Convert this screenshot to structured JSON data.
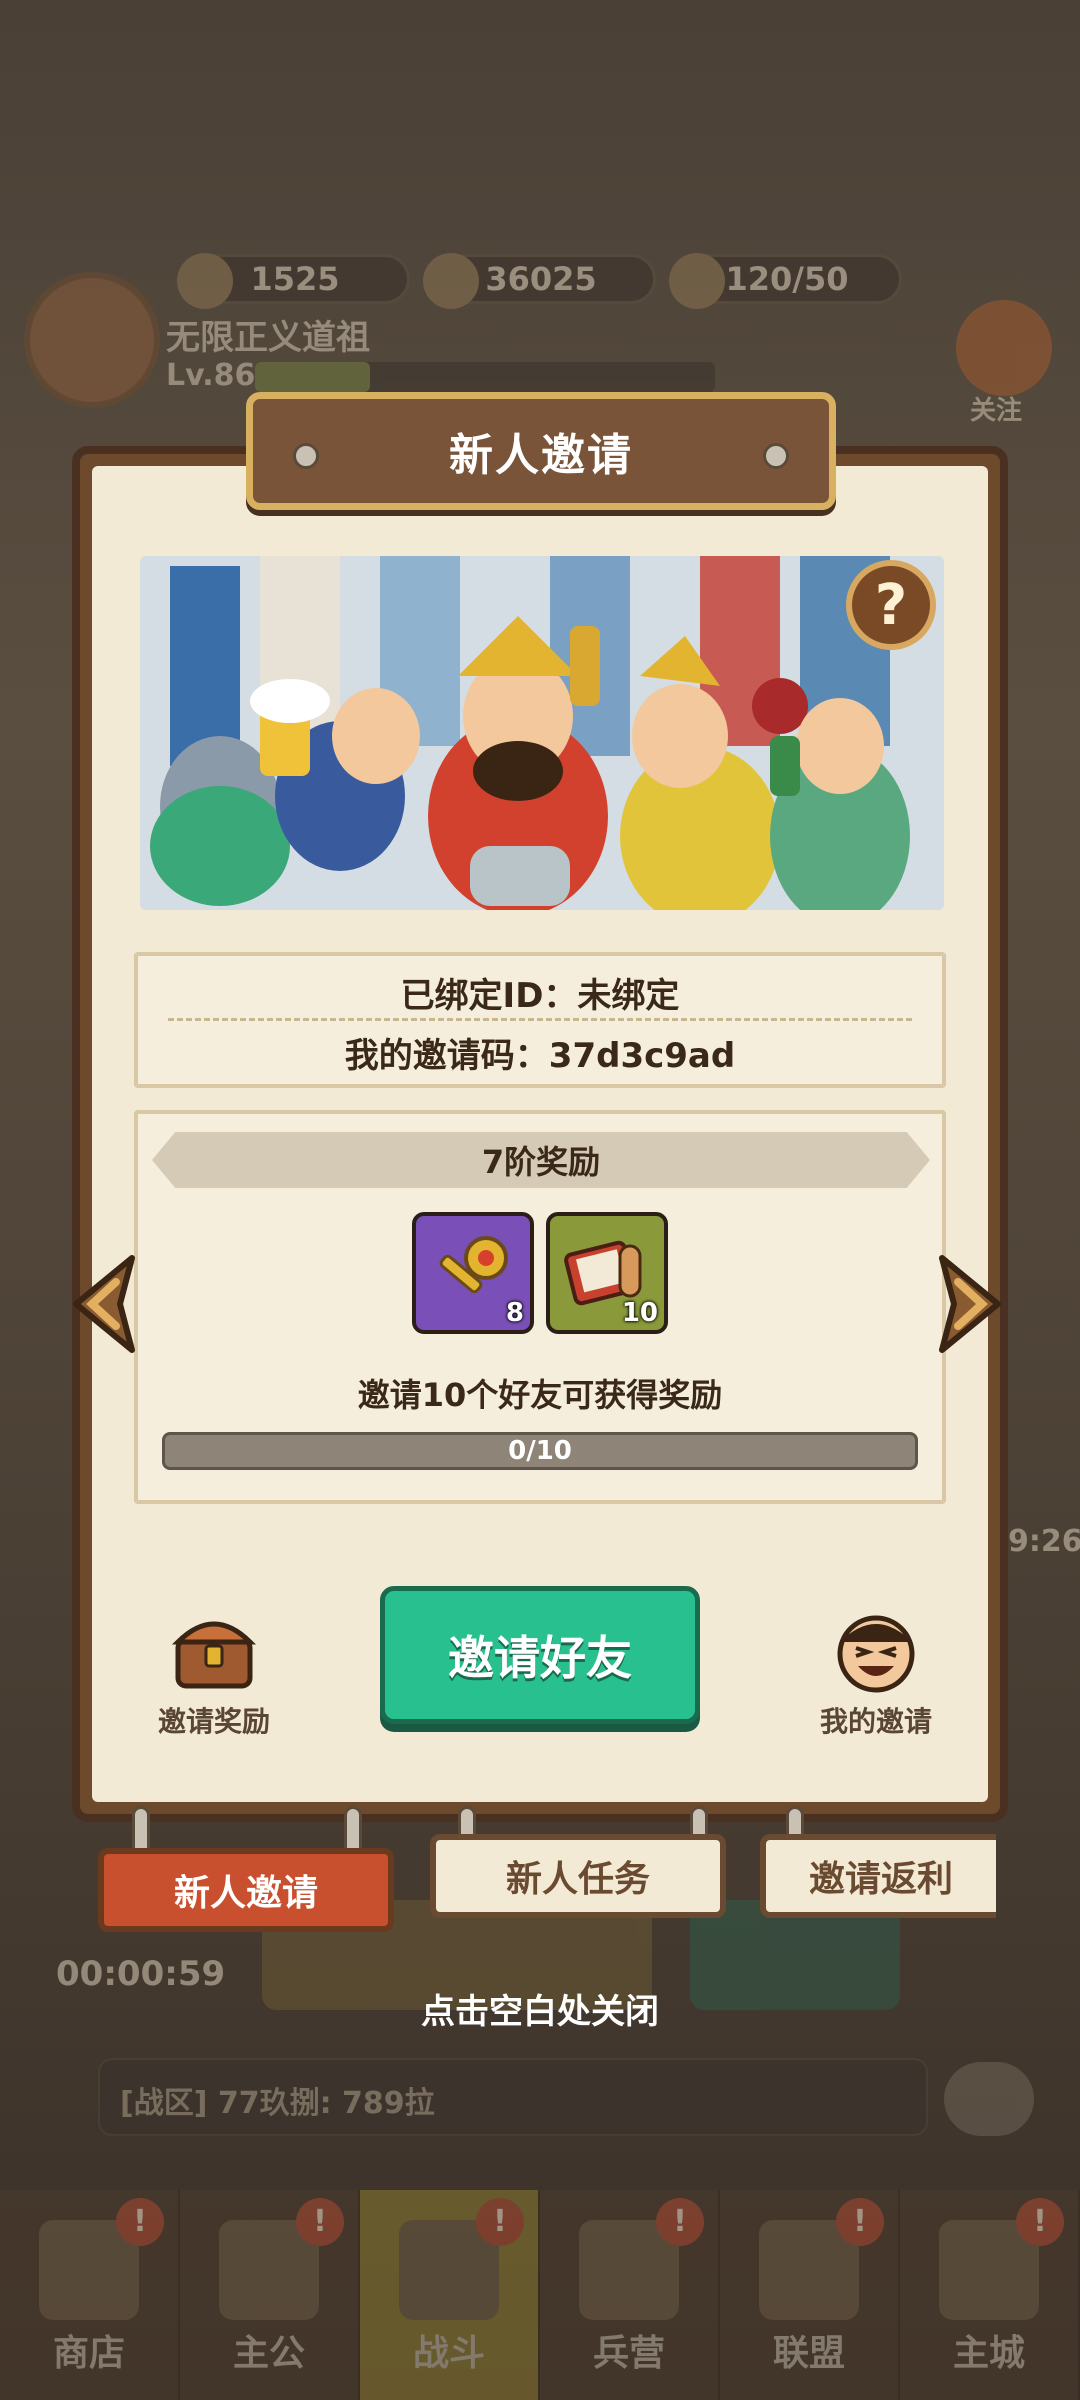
{
  "background": {
    "resources": [
      {
        "name": "gold-ingot",
        "value": "1525"
      },
      {
        "name": "coin",
        "value": "36025"
      },
      {
        "name": "stamina",
        "value": "120/50"
      }
    ],
    "player": {
      "name": "无限正义道祖",
      "level": "Lv.86"
    },
    "follow_label": "关注",
    "side_timer": "9:26",
    "left_timer": "00:00:59",
    "chat_text": "[战区] 77玖捌: 789拉",
    "nav": [
      {
        "label": "商店"
      },
      {
        "label": "主公"
      },
      {
        "label": "战斗"
      },
      {
        "label": "兵营"
      },
      {
        "label": "联盟"
      },
      {
        "label": "主城"
      }
    ]
  },
  "modal": {
    "title": "新人邀请",
    "bound_id_line": "已绑定ID：未绑定",
    "invite_code_line": "我的邀请码：37d3c9ad",
    "tier_label": "7阶奖励",
    "rewards": [
      {
        "name": "golden-key",
        "count": "8"
      },
      {
        "name": "scroll-book",
        "count": "10"
      }
    ],
    "condition_text": "邀请10个好友可获得奖励",
    "progress_text": "0/10",
    "progress_fraction": 0,
    "invite_button": "邀请好友",
    "invite_rewards_label": "邀请奖励",
    "my_invites_label": "我的邀请"
  },
  "tabs": [
    {
      "label": "新人邀请",
      "active": true
    },
    {
      "label": "新人任务",
      "active": false
    },
    {
      "label": "邀请返利",
      "active": false
    }
  ],
  "close_hint": "点击空白处关闭",
  "colors": {
    "accent_green": "#27c08e",
    "active_tab": "#c8502e",
    "frame_brown": "#6e4a2c",
    "parchment": "#f3ead6"
  }
}
